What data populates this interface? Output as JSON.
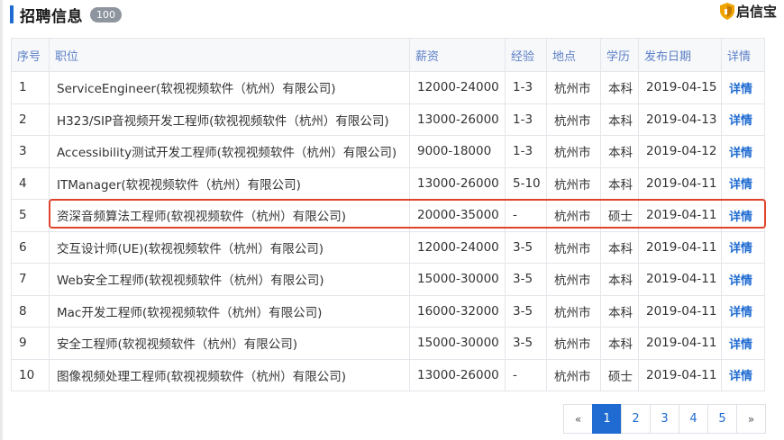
{
  "header": {
    "title": "招聘信息",
    "count": "100",
    "brand": "启信宝"
  },
  "columns": [
    "序号",
    "职位",
    "薪资",
    "经验",
    "地点",
    "学历",
    "发布日期",
    "详情"
  ],
  "rows": [
    {
      "no": "1",
      "position": "ServiceEngineer(软视视频软件（杭州）有限公司)",
      "salary": "12000-24000",
      "exp": "1-3",
      "loc": "杭州市",
      "edu": "本科",
      "date": "2019-04-15",
      "detail": "详情"
    },
    {
      "no": "2",
      "position": "H323/SIP音视频开发工程师(软视视频软件（杭州）有限公司)",
      "salary": "13000-26000",
      "exp": "1-3",
      "loc": "杭州市",
      "edu": "本科",
      "date": "2019-04-13",
      "detail": "详情"
    },
    {
      "no": "3",
      "position": "Accessibility测试开发工程师(软视视频软件（杭州）有限公司)",
      "salary": "9000-18000",
      "exp": "1-3",
      "loc": "杭州市",
      "edu": "本科",
      "date": "2019-04-12",
      "detail": "详情"
    },
    {
      "no": "4",
      "position": "ITManager(软视视频软件（杭州）有限公司)",
      "salary": "13000-26000",
      "exp": "5-10",
      "loc": "杭州市",
      "edu": "本科",
      "date": "2019-04-11",
      "detail": "详情"
    },
    {
      "no": "5",
      "position": "资深音频算法工程师(软视视频软件（杭州）有限公司)",
      "salary": "20000-35000",
      "exp": "-",
      "loc": "杭州市",
      "edu": "硕士",
      "date": "2019-04-11",
      "detail": "详情"
    },
    {
      "no": "6",
      "position": "交互设计师(UE)(软视视频软件（杭州）有限公司)",
      "salary": "12000-24000",
      "exp": "3-5",
      "loc": "杭州市",
      "edu": "本科",
      "date": "2019-04-11",
      "detail": "详情"
    },
    {
      "no": "7",
      "position": "Web安全工程师(软视视频软件（杭州）有限公司)",
      "salary": "15000-30000",
      "exp": "3-5",
      "loc": "杭州市",
      "edu": "本科",
      "date": "2019-04-11",
      "detail": "详情"
    },
    {
      "no": "8",
      "position": "Mac开发工程师(软视视频软件（杭州）有限公司)",
      "salary": "16000-32000",
      "exp": "3-5",
      "loc": "杭州市",
      "edu": "本科",
      "date": "2019-04-11",
      "detail": "详情"
    },
    {
      "no": "9",
      "position": "安全工程师(软视视频软件（杭州）有限公司)",
      "salary": "15000-30000",
      "exp": "3-5",
      "loc": "杭州市",
      "edu": "本科",
      "date": "2019-04-11",
      "detail": "详情"
    },
    {
      "no": "10",
      "position": "图像视频处理工程师(软视视频软件（杭州）有限公司)",
      "salary": "13000-26000",
      "exp": "-",
      "loc": "杭州市",
      "edu": "硕士",
      "date": "2019-04-11",
      "detail": "详情"
    }
  ],
  "highlighted_row": "5",
  "pagination": {
    "prev": "«",
    "pages": [
      "1",
      "2",
      "3",
      "4",
      "5"
    ],
    "current": "1",
    "next": "»"
  },
  "colors": {
    "accent": "#1f6bd1",
    "highlight_border": "#e0432c",
    "header_text": "#5b7fc7",
    "brand_shield": "#f0a400"
  },
  "icons": {
    "brand": "shield-icon"
  }
}
